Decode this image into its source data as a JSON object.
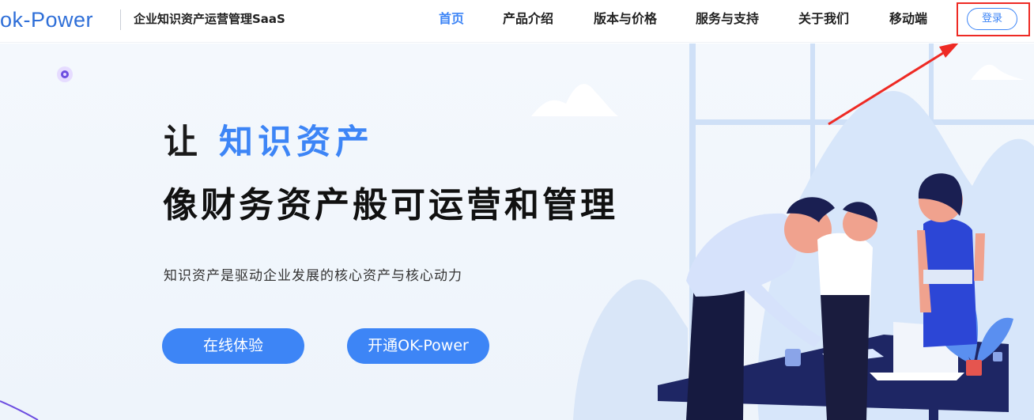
{
  "header": {
    "logo": "ok-Power",
    "tagline": "企业知识资产运营管理SaaS",
    "nav": [
      {
        "label": "首页",
        "active": true
      },
      {
        "label": "产品介绍",
        "active": false
      },
      {
        "label": "版本与价格",
        "active": false
      },
      {
        "label": "服务与支持",
        "active": false
      },
      {
        "label": "关于我们",
        "active": false
      },
      {
        "label": "移动端",
        "active": false
      }
    ],
    "login_label": "登录"
  },
  "hero": {
    "headline_prefix": "让 ",
    "headline_accent": "知识资产",
    "headline_line2": "像财务资产般可运营和管理",
    "subline": "知识资产是驱动企业发展的核心资产与核心动力",
    "buttons": {
      "trial": "在线体验",
      "open": "开通OK-Power"
    }
  },
  "colors": {
    "accent": "#3d85f6",
    "highlight_box": "#ee2a24",
    "headline_text": "#111111",
    "hero_bg": "#f2f6fc"
  },
  "icons": [
    "decor-circle-icon",
    "annotation-arrow-icon"
  ]
}
